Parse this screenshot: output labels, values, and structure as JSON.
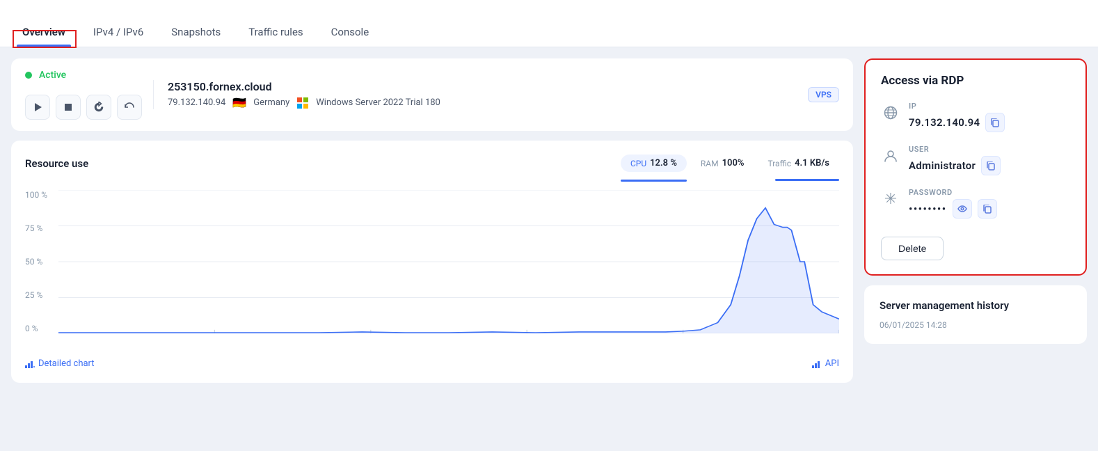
{
  "tabs": [
    {
      "id": "overview",
      "label": "Overview",
      "active": true
    },
    {
      "id": "ipv4ipv6",
      "label": "IPv4 / IPv6",
      "active": false
    },
    {
      "id": "snapshots",
      "label": "Snapshots",
      "active": false
    },
    {
      "id": "traffic-rules",
      "label": "Traffic rules",
      "active": false
    },
    {
      "id": "console",
      "label": "Console",
      "active": false
    }
  ],
  "server": {
    "status": "Active",
    "status_color": "#22c55e",
    "hostname": "253150.fornex.cloud",
    "ip": "79.132.140.94",
    "country": "Germany",
    "flag": "🇩🇪",
    "os": "Windows Server 2022 Trial 180",
    "type": "VPS"
  },
  "controls": {
    "play": "▶",
    "stop": "■",
    "restart": "↺",
    "reset": "↩"
  },
  "resource_use": {
    "title": "Resource use",
    "metrics": [
      {
        "label": "CPU",
        "value": "12.8 %",
        "active": true
      },
      {
        "label": "RAM",
        "value": "100%",
        "active": false
      },
      {
        "label": "Traffic",
        "value": "4.1 KB/s",
        "active": false
      }
    ],
    "y_labels": [
      "100 %",
      "75 %",
      "50 %",
      "25 %",
      "0 %"
    ],
    "detailed_chart": "Detailed chart",
    "api": "API"
  },
  "rdp": {
    "title": "Access via RDP",
    "ip_label": "IP",
    "ip_value": "79.132.140.94",
    "user_label": "USER",
    "user_value": "Administrator",
    "password_label": "PASSWORD",
    "password_value": "••••••••",
    "delete_label": "Delete"
  },
  "history": {
    "title": "Server management history",
    "timestamp": "06/01/2025 14:28"
  }
}
